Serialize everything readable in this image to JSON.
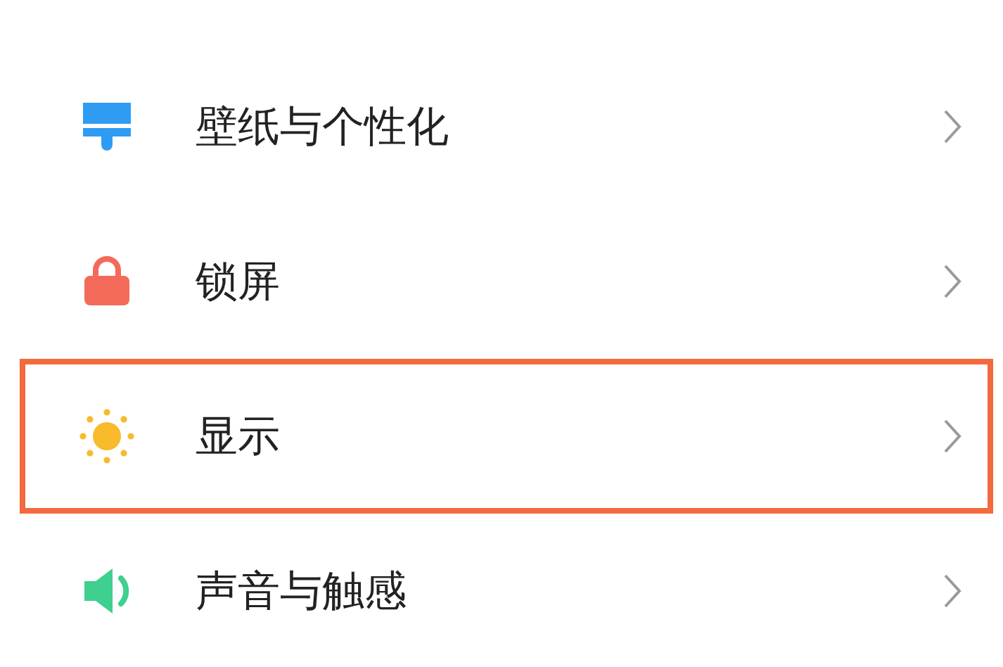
{
  "settings": [
    {
      "label": "壁纸与个性化",
      "kind": "brush",
      "highlighted": false
    },
    {
      "label": "锁屏",
      "kind": "lock",
      "highlighted": false
    },
    {
      "label": "显示",
      "kind": "sun",
      "highlighted": true
    },
    {
      "label": "声音与触感",
      "kind": "speaker",
      "highlighted": false
    }
  ]
}
